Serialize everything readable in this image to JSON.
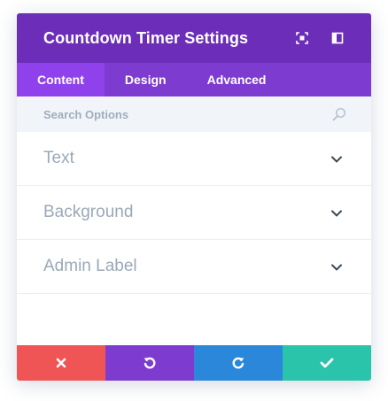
{
  "header": {
    "title": "Countdown Timer Settings",
    "icons": [
      "fullscreen-icon",
      "split-view-icon"
    ]
  },
  "tabs": [
    {
      "label": "Content",
      "active": true
    },
    {
      "label": "Design",
      "active": false
    },
    {
      "label": "Advanced",
      "active": false
    }
  ],
  "search": {
    "placeholder": "Search Options",
    "value": ""
  },
  "sections": [
    {
      "label": "Text"
    },
    {
      "label": "Background"
    },
    {
      "label": "Admin Label"
    }
  ],
  "footer": {
    "buttons": [
      {
        "name": "discard",
        "icon": "close-icon",
        "color": "#ef5555"
      },
      {
        "name": "undo",
        "icon": "undo-icon",
        "color": "#7e3bd0"
      },
      {
        "name": "redo",
        "icon": "redo-icon",
        "color": "#2b87da"
      },
      {
        "name": "save",
        "icon": "check-icon",
        "color": "#29c4a9"
      }
    ]
  },
  "colors": {
    "header": "#6c2eb9",
    "tabs": "#7e3bd0",
    "active_tab": "#8f42ec",
    "search_bg": "#f1f5f9",
    "section_text": "#9aa9b8"
  }
}
